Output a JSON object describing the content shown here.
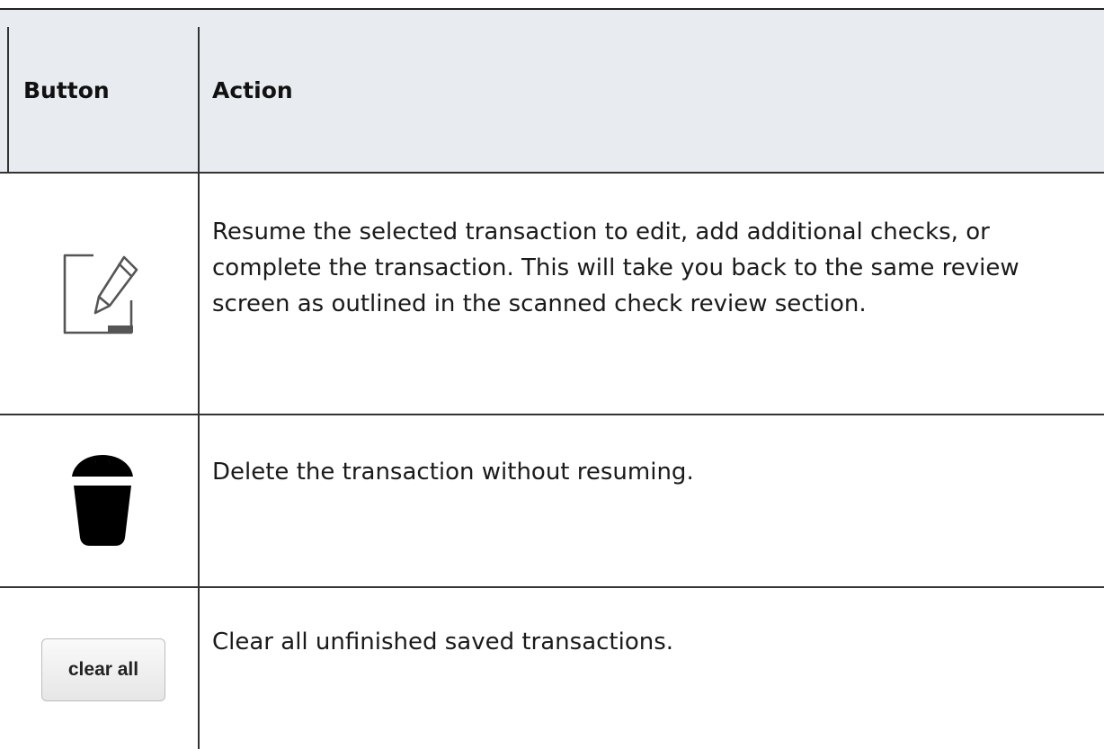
{
  "table": {
    "headers": {
      "button": "Button",
      "action": "Action"
    },
    "rows": [
      {
        "button_icon": "edit-icon",
        "action": "Resume the selected transaction to edit, add additional checks, or complete the transaction. This will take you back to the same review screen as outlined in the scanned check review section."
      },
      {
        "button_icon": "trash-icon",
        "action": "Delete the transaction without resuming."
      },
      {
        "button_label": "clear all",
        "action": "Clear all unfinished saved transactions."
      }
    ]
  },
  "colors": {
    "header_background": "#e8ebf0",
    "rule": "#333333",
    "text": "#111111"
  }
}
